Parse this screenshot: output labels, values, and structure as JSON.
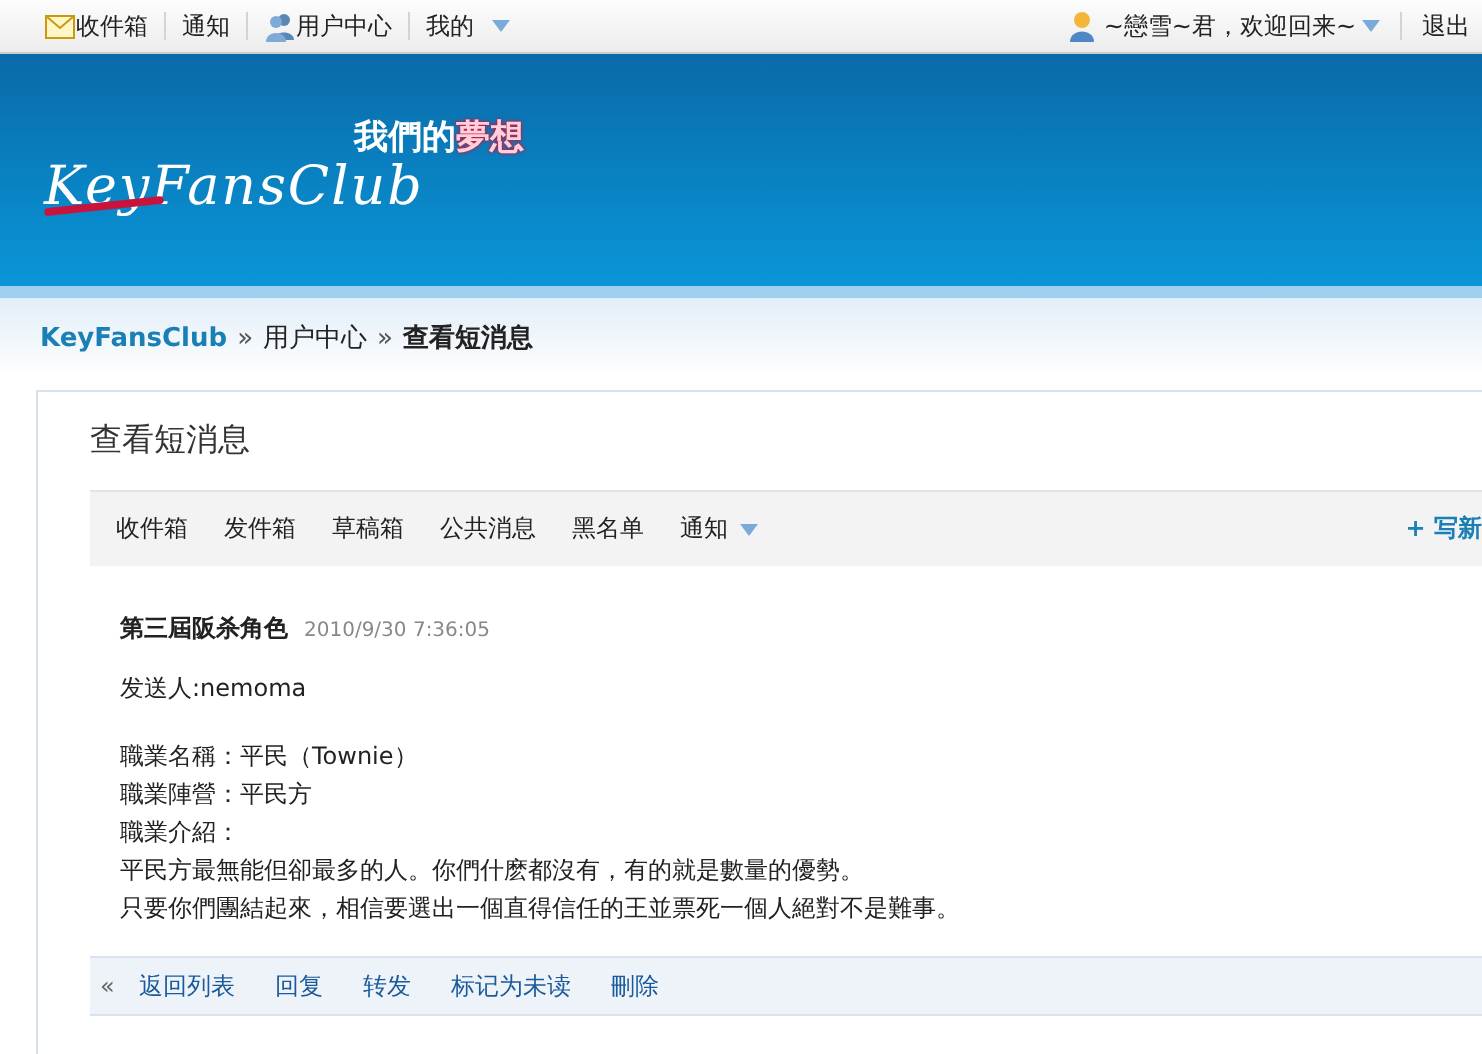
{
  "top_bar": {
    "inbox": "收件箱",
    "notice": "通知",
    "user_center": "用户中心",
    "mine": "我的",
    "greeting": "~戀雪~君，欢迎回来~",
    "logout": "退出"
  },
  "banner": {
    "slogan_white": "我們的",
    "slogan_red": "夢想",
    "logo": "KeyFansClub"
  },
  "breadcrumb": [
    {
      "label": "KeyFansClub",
      "kind": "link"
    },
    {
      "label": "»",
      "kind": "sep"
    },
    {
      "label": "用户中心",
      "kind": "link"
    },
    {
      "label": "»",
      "kind": "sep"
    },
    {
      "label": "查看短消息",
      "kind": "current"
    }
  ],
  "page_title": "查看短消息",
  "tabs": [
    {
      "label": "收件箱",
      "has_menu": false
    },
    {
      "label": "发件箱",
      "has_menu": false
    },
    {
      "label": "草稿箱",
      "has_menu": false
    },
    {
      "label": "公共消息",
      "has_menu": false
    },
    {
      "label": "黑名单",
      "has_menu": false
    },
    {
      "label": "通知",
      "has_menu": true
    }
  ],
  "compose": "+ 写新",
  "message": {
    "subject": "第三屆阪杀角色",
    "time": "2010/9/30 7:36:05",
    "sender": "发送人:nemoma",
    "body": [
      "職業名稱：平民（Townie）",
      "職業陣營：平民方",
      "職業介紹：",
      "平民方最無能但卻最多的人。你們什麽都沒有，有的就是數量的優勢。",
      "只要你們團結起來，相信要選出一個直得信任的王並票死一個人絕對不是難事。"
    ]
  },
  "actions": {
    "back_mark": "«",
    "items": [
      "返回列表",
      "回复",
      "转发",
      "标记为未读",
      "刪除"
    ]
  }
}
